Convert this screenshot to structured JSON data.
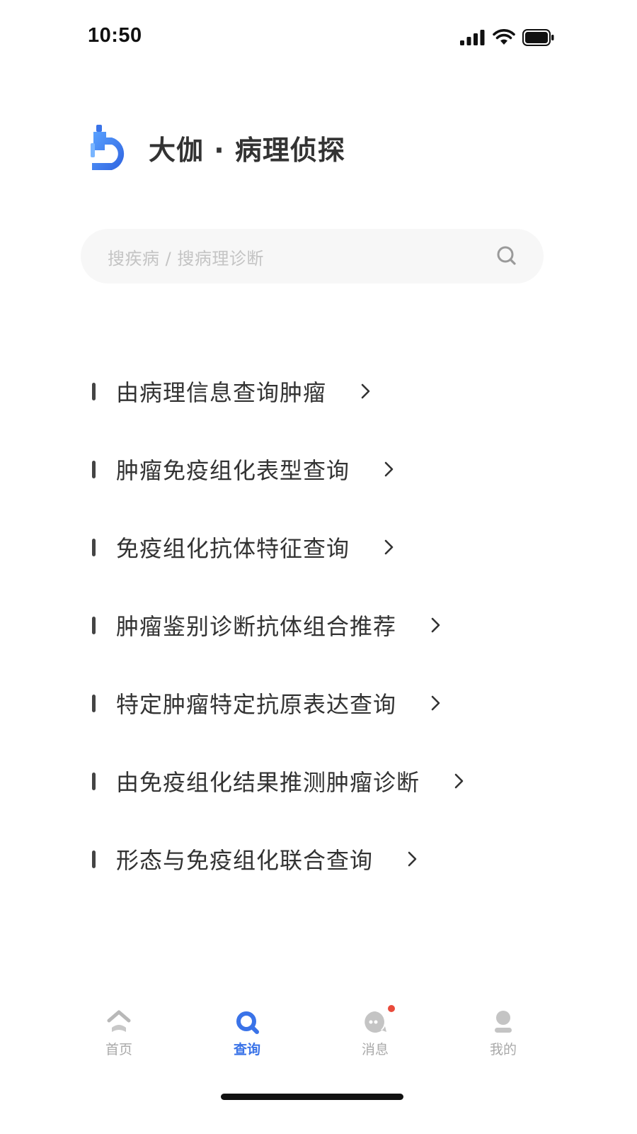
{
  "status_bar": {
    "time": "10:50",
    "icons": [
      "signal-icon",
      "wifi-icon",
      "battery-icon"
    ]
  },
  "brand": {
    "logo": "microscope-logo-icon",
    "title": "大伽 · 病理侦探",
    "logo_color": "#3a73e8"
  },
  "search": {
    "placeholder": "搜疾病 / 搜病理诊断",
    "icon": "search-icon"
  },
  "menu": {
    "items": [
      {
        "label": "由病理信息查询肿瘤"
      },
      {
        "label": "肿瘤免疫组化表型查询"
      },
      {
        "label": "免疫组化抗体特征查询"
      },
      {
        "label": "肿瘤鉴别诊断抗体组合推荐"
      },
      {
        "label": "特定肿瘤特定抗原表达查询"
      },
      {
        "label": "由免疫组化结果推测肿瘤诊断"
      },
      {
        "label": "形态与免疫组化联合查询"
      }
    ]
  },
  "tab_bar": {
    "tabs": [
      {
        "label": "首页",
        "icon": "home-icon",
        "active": false
      },
      {
        "label": "查询",
        "icon": "query-icon",
        "active": true
      },
      {
        "label": "消息",
        "icon": "message-icon",
        "active": false,
        "badge": true
      },
      {
        "label": "我的",
        "icon": "profile-icon",
        "active": false
      }
    ],
    "active_color": "#3a73e8",
    "inactive_color": "#a9a9a9",
    "badge_color": "#e94a3b"
  }
}
